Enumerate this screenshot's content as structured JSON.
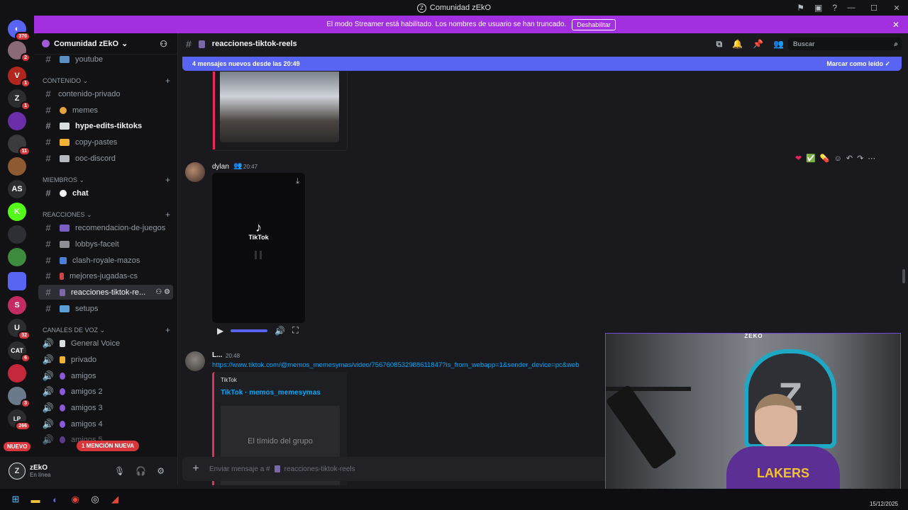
{
  "window": {
    "title": "Comunidad zEkO"
  },
  "streamer_banner": {
    "text": "El modo Streamer está habilitado. Los nombres de usuario se han truncado.",
    "button": "Deshabilitar"
  },
  "guilds": [
    {
      "label": "",
      "badge": "370",
      "color": "#5865f2"
    },
    {
      "label": "",
      "badge": "2",
      "color": "#8a6a78"
    },
    {
      "label": "V",
      "badge": "1",
      "color": "#b3261e"
    },
    {
      "label": "Z",
      "badge": "1",
      "color": "#2b2d31"
    },
    {
      "label": "",
      "badge": "",
      "color": "#6a2fa8"
    },
    {
      "label": "",
      "badge": "11",
      "color": "#3b3b3f"
    },
    {
      "label": "",
      "badge": "",
      "color": "#8d5a32"
    },
    {
      "label": "AS",
      "badge": "",
      "color": "#2b2d31"
    },
    {
      "label": "K",
      "badge": "",
      "color": "#53fc18"
    },
    {
      "label": "",
      "badge": "",
      "color": "#2e2f35"
    },
    {
      "label": "",
      "badge": "",
      "color": "#3d8b3d"
    },
    {
      "label": "",
      "badge": "",
      "color": "#5865f2"
    },
    {
      "label": "S",
      "badge": "",
      "color": "#c42b63"
    },
    {
      "label": "U",
      "badge": "32",
      "color": "#2b2d31"
    },
    {
      "label": "CAT",
      "badge": "6",
      "color": "#2b2d31"
    },
    {
      "label": "",
      "badge": "",
      "color": "#c4283a"
    },
    {
      "label": "",
      "badge": "3",
      "color": "#6a7a8a"
    },
    {
      "label": "LP",
      "badge": "266",
      "color": "#2b2d31"
    }
  ],
  "nuevo": "NUEVO",
  "server": {
    "name": "Comunidad zEkO"
  },
  "sidebar": {
    "top_channel": "youtube",
    "categories": [
      {
        "name": "CONTENIDO"
      },
      {
        "name": "MIEMBROS"
      },
      {
        "name": "REACCIONES"
      },
      {
        "name": "CANALES DE VOZ"
      }
    ],
    "channels": [
      "contenido-privado",
      "memes",
      "hype-edits-tiktoks",
      "copy-pastes",
      "ooc-discord",
      "chat",
      "recomendacion-de-juegos",
      "lobbys-faceit",
      "clash-royale-mazos",
      "mejores-jugadas-cs",
      "reacciones-tiktok-re...",
      "setups"
    ],
    "voice": [
      "General Voice",
      "privado",
      "amigos",
      "amigos 2",
      "amigos 3",
      "amigos 4",
      "amigos 5"
    ],
    "mention_pill": "1 MENCIÓN NUEVA"
  },
  "user": {
    "name": "zEkO",
    "status": "En línea"
  },
  "channel_header": {
    "name": "reacciones-tiktok-reels",
    "search_placeholder": "Buscar"
  },
  "new_messages": {
    "text": "4 mensajes nuevos desde las 20:49",
    "mark_read": "Marcar como leído"
  },
  "messages": [
    {
      "author": "dylan",
      "time": "20:47",
      "video_label": "TikTok"
    },
    {
      "author": "L...",
      "time": "20:48",
      "link": "https://www.tiktok.com/@memos_memesymas/video/7567608532988611847?is_from_webapp=1&sender_device=pc&web",
      "embed_provider": "TikTok",
      "embed_title": "TikTok · memos_memesymas",
      "embed_image_text": "El tímido del grupo"
    }
  ],
  "composer": {
    "placeholder_prefix": "Enviar mensaje a #",
    "placeholder_channel": "reacciones-tiktok-reels"
  },
  "webcam": {
    "title": "ZEKO",
    "shirt_text": "LAKERS"
  },
  "taskbar": {
    "clock": "15/12/2025"
  }
}
